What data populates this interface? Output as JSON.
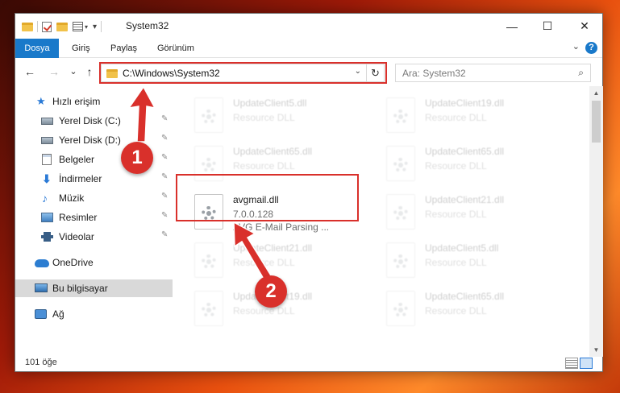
{
  "window": {
    "title": "System32",
    "minimize_glyph": "—",
    "maximize_glyph": "☐",
    "close_glyph": "✕"
  },
  "ribbon": {
    "tabs": [
      "Dosya",
      "Giriş",
      "Paylaş",
      "Görünüm"
    ],
    "help_glyph": "?"
  },
  "nav": {
    "back_glyph": "←",
    "forward_glyph": "→",
    "recent_glyph": "⌄",
    "up_glyph": "↑",
    "address": "C:\\Windows\\System32",
    "refresh_glyph": "↻",
    "search_placeholder": "Ara: System32",
    "search_icon": "⌕"
  },
  "sidebar": {
    "items": [
      {
        "label": "Hızlı erişim",
        "icon": "star-icon"
      },
      {
        "label": "Yerel Disk (C:)",
        "icon": "drive-icon",
        "pinned": true
      },
      {
        "label": "Yerel Disk (D:)",
        "icon": "drive-icon",
        "pinned": true
      },
      {
        "label": "Belgeler",
        "icon": "documents-icon",
        "pinned": true
      },
      {
        "label": "İndirmeler",
        "icon": "download-icon",
        "pinned": true
      },
      {
        "label": "Müzik",
        "icon": "music-icon",
        "pinned": true
      },
      {
        "label": "Resimler",
        "icon": "pictures-icon",
        "pinned": true
      },
      {
        "label": "Videolar",
        "icon": "videos-icon",
        "pinned": true
      },
      {
        "label": "OneDrive",
        "icon": "onedrive-icon"
      },
      {
        "label": "Bu bilgisayar",
        "icon": "computer-icon",
        "selected": true
      },
      {
        "label": "Ağ",
        "icon": "network-icon"
      }
    ],
    "pin_glyph": "📌"
  },
  "files": [
    {
      "name": "UpdateClient5.dll",
      "line2": "Resource DLL",
      "faded": true
    },
    {
      "name": "UpdateClient19.dll",
      "line2": "Resource DLL",
      "faded": true
    },
    {
      "name": "UpdateClient65.dll",
      "line2": "Resource DLL",
      "faded": true
    },
    {
      "name": "UpdateClient65.dll",
      "line2": "Resource DLL",
      "faded": true
    },
    {
      "name": "avgmail.dll",
      "line2": "7.0.0.128",
      "line3": "AVG E-Mail Parsing ...",
      "faded": false
    },
    {
      "name": "UpdateClient21.dll",
      "line2": "Resource DLL",
      "faded": true
    },
    {
      "name": "UpdateClient21.dll",
      "line2": "Resource DLL",
      "faded": true
    },
    {
      "name": "UpdateClient5.dll",
      "line2": "Resource DLL",
      "faded": true
    },
    {
      "name": "UpdateClient19.dll",
      "line2": "Resource DLL",
      "faded": true
    },
    {
      "name": "UpdateClient65.dll",
      "line2": "Resource DLL",
      "faded": true
    }
  ],
  "status": {
    "count_text": "101 öğe"
  },
  "callouts": [
    "1",
    "2"
  ],
  "colors": {
    "accent": "#1979ca",
    "highlight": "#d9302b"
  }
}
